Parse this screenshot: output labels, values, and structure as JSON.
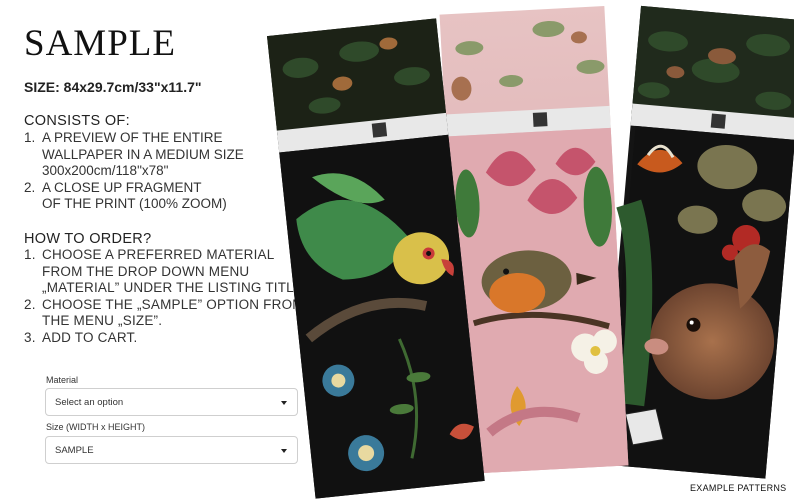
{
  "heading": "SAMPLE",
  "size_line": "SIZE: 84x29.7cm/33\"x11.7\"",
  "consists": {
    "title": "CONSISTS OF:",
    "items": [
      {
        "num": "1.",
        "text": " A PREVIEW OF THE ENTIRE\n WALLPAPER IN A MEDIUM SIZE\n 300x200cm/118\"x78\""
      },
      {
        "num": "2.",
        "text": " A CLOSE UP FRAGMENT\n OF THE PRINT (100% ZOOM)"
      }
    ]
  },
  "how_to_order": {
    "title": "HOW TO ORDER?",
    "items": [
      {
        "num": "1.",
        "text": " CHOOSE A PREFERRED MATERIAL\n FROM THE DROP DOWN MENU\n „MATERIAL” UNDER THE LISTING TITLE."
      },
      {
        "num": "2.",
        "text": " CHOOSE  THE „SAMPLE” OPTION FROM\n THE MENU „SIZE”."
      },
      {
        "num": "3.",
        "text": " ADD TO CART."
      }
    ]
  },
  "material_field": {
    "label": "Material",
    "value": "Select an option"
  },
  "size_field": {
    "label": "Size (WIDTH x HEIGHT)",
    "value": "SAMPLE"
  },
  "footer_note": "EXAMPLE PATTERNS",
  "colors": {
    "panel_dark": "#141414",
    "panel_pink": "#e9b9bd",
    "parrot_green": "#3f8a4a",
    "robin_orange": "#d9772a",
    "hare_brown": "#8a5a3b"
  }
}
